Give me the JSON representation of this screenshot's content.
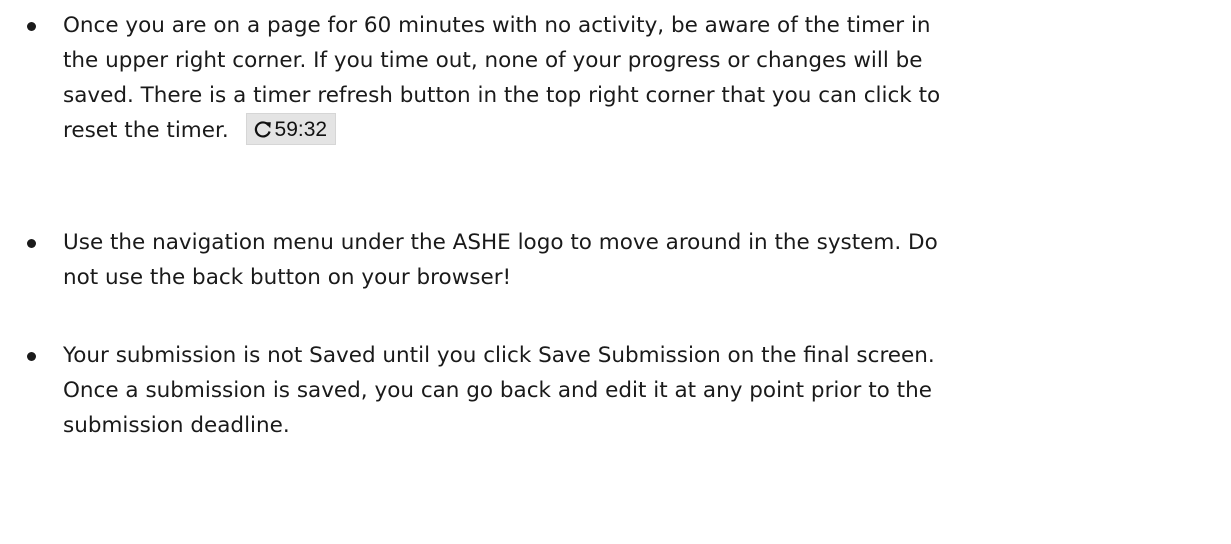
{
  "bullets": [
    {
      "lines": [
        "Once you are on a page for 60 minutes with no activity, be aware of the timer in",
        "the upper right corner. If you time out, none of your progress or changes will be",
        "saved. There is a timer refresh button in the top right corner that you can click to",
        "reset the timer."
      ],
      "timer": {
        "icon": "refresh-icon",
        "value": "59:32"
      }
    },
    {
      "lines": [
        "Use the navigation menu under the ASHE logo to move around in the system. Do",
        "not use the back button on your browser!"
      ]
    },
    {
      "lines": [
        "Your submission is not Saved until you click Save Submission on the final screen.",
        "Once a submission is saved, you can go back and edit it at any point prior to the",
        "submission deadline."
      ]
    }
  ]
}
